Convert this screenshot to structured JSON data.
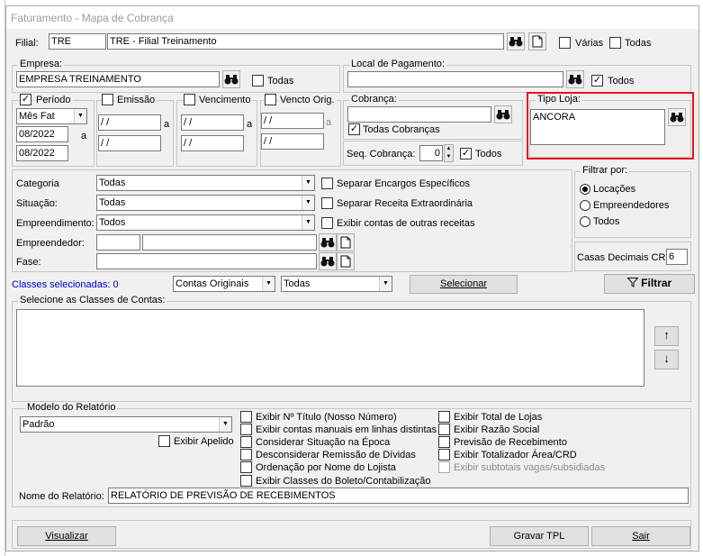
{
  "window": {
    "title": "Faturamento - Mapa de Cobrança"
  },
  "filial": {
    "label": "Filial:",
    "code": "TRE",
    "name": "TRE - Filial Treinamento",
    "varias": "Várias",
    "todas": "Todas"
  },
  "empresa": {
    "legend": "Empresa:",
    "value": "EMPRESA TREINAMENTO",
    "todas": "Todas"
  },
  "local_pagamento": {
    "legend": "Local de Pagamento:",
    "value": "",
    "todos": "Todos"
  },
  "periodo": {
    "label": "Período",
    "mode": "Mês Fat",
    "from": "08/2022",
    "to": "08/2022",
    "sep": "a"
  },
  "emissao": {
    "label": "Emissão",
    "from": " / /",
    "to": " / /",
    "sep": "a"
  },
  "vencimento": {
    "label": "Vencimento",
    "from": " / /",
    "to": " / /",
    "sep": "a"
  },
  "vencto_orig": {
    "label": "Vencto Orig.",
    "from": " / /",
    "to": " / /",
    "sep": "a"
  },
  "cobranca": {
    "legend": "Cobrança:",
    "value": "",
    "todas": "Todas Cobranças",
    "seq_label": "Seq. Cobrança:",
    "seq_value": "0",
    "todos": "Todos"
  },
  "tipo_loja": {
    "legend": "Tipo Loja:",
    "value": "ANCORA"
  },
  "filters": {
    "categoria": {
      "label": "Categoria",
      "value": "Todas"
    },
    "situacao": {
      "label": "Situação:",
      "value": "Todas"
    },
    "empreendimento": {
      "label": "Empreendimento:",
      "value": "Todos"
    },
    "empreendedor": {
      "label": "Empreendedor:",
      "code": "",
      "name": ""
    },
    "fase": {
      "label": "Fase:",
      "value": ""
    }
  },
  "options": {
    "separar_encargos": "Separar Encargos Específicos",
    "separar_receita": "Separar Receita Extraordinária",
    "exibir_outras": "Exibir contas de outras receitas"
  },
  "filtrar_por": {
    "legend": "Filtrar por:",
    "options": [
      "Locações",
      "Empreendedores",
      "Todos"
    ]
  },
  "casas": {
    "label": "Casas Decimais CRD",
    "value": "6"
  },
  "classes": {
    "selected_label": "Classes selecionadas: 0",
    "contas": "Contas Originais",
    "todas": "Todas",
    "selecionar": "Selecionar",
    "filtrar": "Filtrar",
    "legend": "Selecione as Classes de Contas:",
    "up": "↑",
    "down": "↓"
  },
  "modelo": {
    "legend": "Modelo do Relatório",
    "value": "Padrão",
    "exibir_apelido": "Exibir Apelido",
    "col1": [
      "Exibir Nº Título (Nosso Número)",
      "Exibir contas manuais em linhas distintas",
      "Considerar Situação na Época",
      "Desconsiderar Remissão de Dívidas",
      "Ordenação por Nome do Lojista",
      "Exibir Classes do Boleto/Contabilização"
    ],
    "col2": [
      "Exibir Total de Lojas",
      "Exibir Razão Social",
      "Previsão de Recebimento",
      "Exibir Totalizador Área/CRD",
      "Exibir subtotais vagas/subsidiadas"
    ],
    "nome_label": "Nome do Relatório:",
    "nome_value": "RELATÓRIO DE PREVISÃO DE RECEBIMENTOS"
  },
  "footer": {
    "visualizar": "Visualizar",
    "gravar": "Gravar TPL",
    "sair": "Sair"
  },
  "check_mark": "✓"
}
